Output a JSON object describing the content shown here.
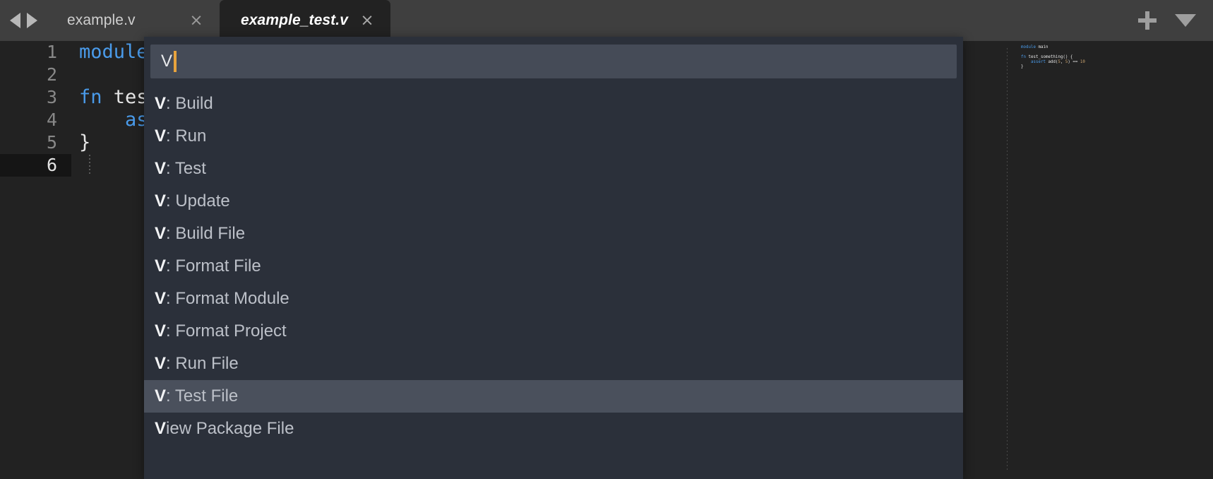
{
  "window": {
    "title": "example_test.v"
  },
  "tabbar": {
    "nav_back_icon": "triangle-left-icon",
    "nav_forward_icon": "triangle-right-icon",
    "tabs": [
      {
        "label": "example.v",
        "active": false,
        "close_glyph": "×"
      },
      {
        "label": "example_test.v",
        "active": true,
        "close_glyph": "×"
      }
    ],
    "actions": {
      "new_tab_icon": "plus-icon",
      "tab_menu_icon": "chevron-down-icon"
    }
  },
  "editor": {
    "line_numbers": [
      "1",
      "2",
      "3",
      "4",
      "5",
      "6"
    ],
    "current_line": "6",
    "lines": [
      {
        "number": "1",
        "tokens": [
          {
            "t": "module",
            "c": "kw"
          },
          {
            "t": " main",
            "c": "plain"
          }
        ]
      },
      {
        "number": "2",
        "tokens": [
          {
            "t": "",
            "c": "plain"
          }
        ]
      },
      {
        "number": "3",
        "tokens": [
          {
            "t": "fn",
            "c": "kw"
          },
          {
            "t": " test_something() {",
            "c": "plain"
          }
        ]
      },
      {
        "number": "4",
        "tokens": [
          {
            "t": "    ",
            "c": "plain"
          },
          {
            "t": "assert",
            "c": "kw"
          },
          {
            "t": " add(",
            "c": "plain"
          },
          {
            "t": "5",
            "c": "num"
          },
          {
            "t": ", ",
            "c": "plain"
          },
          {
            "t": "5",
            "c": "num"
          },
          {
            "t": ") == ",
            "c": "plain"
          },
          {
            "t": "10",
            "c": "num"
          }
        ]
      },
      {
        "number": "5",
        "tokens": [
          {
            "t": "}",
            "c": "plain"
          }
        ]
      },
      {
        "number": "6",
        "tokens": [
          {
            "t": "",
            "c": "plain"
          }
        ]
      }
    ]
  },
  "minimap": {
    "name": "code-minimap"
  },
  "palette": {
    "input_value": "V",
    "input_placeholder": "",
    "items": [
      {
        "match": "V",
        "rest": ": Build",
        "selected": false
      },
      {
        "match": "V",
        "rest": ": Run",
        "selected": false
      },
      {
        "match": "V",
        "rest": ": Test",
        "selected": false
      },
      {
        "match": "V",
        "rest": ": Update",
        "selected": false
      },
      {
        "match": "V",
        "rest": ": Build File",
        "selected": false
      },
      {
        "match": "V",
        "rest": ": Format File",
        "selected": false
      },
      {
        "match": "V",
        "rest": ": Format Module",
        "selected": false
      },
      {
        "match": "V",
        "rest": ": Format Project",
        "selected": false
      },
      {
        "match": "V",
        "rest": ": Run File",
        "selected": false
      },
      {
        "match": "V",
        "rest": ": Test File",
        "selected": true
      },
      {
        "match": "V",
        "rest": "iew Package File",
        "selected": false
      }
    ]
  },
  "colors": {
    "tabbar_bg": "#3f3f3f",
    "editor_bg": "#222222",
    "active_tab_bg": "#222222",
    "palette_bg": "#2b303a",
    "palette_input_bg": "#454b57",
    "palette_selected_bg": "#4a505c",
    "caret": "#e8a33d",
    "keyword": "#4a9bea",
    "text": "#e6e6e6",
    "line_number": "#888888",
    "current_line_bg": "#151515"
  }
}
